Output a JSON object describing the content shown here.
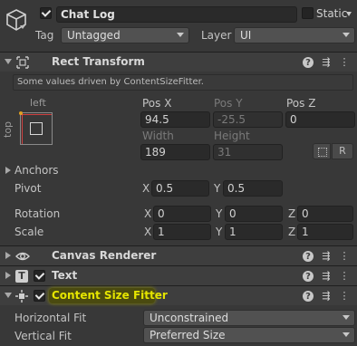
{
  "object": {
    "name": "Chat Log",
    "static_label": "Static",
    "tag_label": "Tag",
    "tag_value": "Untagged",
    "layer_label": "Layer",
    "layer_value": "UI"
  },
  "rect_transform": {
    "title": "Rect Transform",
    "driven_note": "Some values driven by ContentSizeFitter.",
    "anchor_h": "left",
    "anchor_v": "top",
    "pos_x_label": "Pos X",
    "pos_y_label": "Pos Y",
    "pos_z_label": "Pos Z",
    "pos_x": "94.5",
    "pos_y": "-25.5",
    "pos_z": "0",
    "width_label": "Width",
    "height_label": "Height",
    "width": "189",
    "height": "31",
    "r_button": "R",
    "anchors_label": "Anchors",
    "pivot_label": "Pivot",
    "pivot_x": "0.5",
    "pivot_y": "0.5",
    "rotation_label": "Rotation",
    "rot_x": "0",
    "rot_y": "0",
    "rot_z": "0",
    "scale_label": "Scale",
    "scale_x": "1",
    "scale_y": "1",
    "scale_z": "1",
    "axis_x": "X",
    "axis_y": "Y",
    "axis_z": "Z"
  },
  "components": {
    "canvas_renderer": "Canvas Renderer",
    "text": "Text",
    "content_size_fitter": "Content Size Fitter"
  },
  "fitter": {
    "horizontal_label": "Horizontal Fit",
    "horizontal_value": "Unconstrained",
    "vertical_label": "Vertical Fit",
    "vertical_value": "Preferred Size"
  },
  "icons": {
    "help": "help-icon",
    "presets": "presets-icon",
    "more": "more-icon"
  },
  "colors": {
    "highlight": "#e5e500",
    "background": "#383838",
    "header": "#3e3e3e"
  }
}
